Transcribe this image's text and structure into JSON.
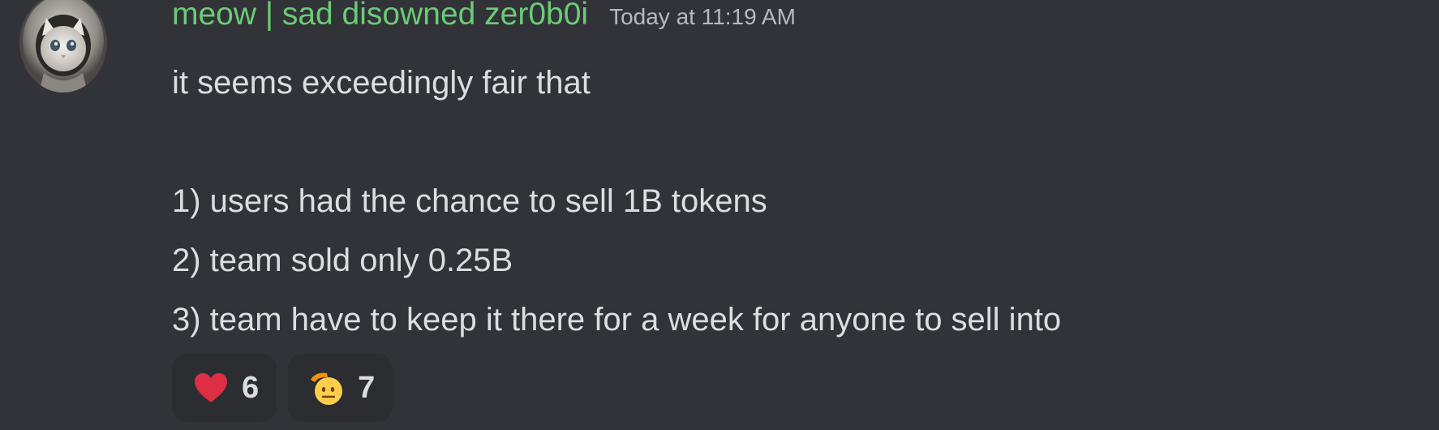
{
  "message": {
    "author": "meow | sad disowned zer0b0i",
    "timestamp": "Today at 11:19 AM",
    "lines": [
      "it seems exceedingly fair that",
      "",
      "1) users had the chance to sell 1B tokens",
      "2) team sold only 0.25B",
      "3) team have to keep it there for a week for anyone to sell into"
    ],
    "avatar_icon": "cat-astronaut-avatar"
  },
  "reactions": [
    {
      "icon": "red-heart-icon",
      "count": "6"
    },
    {
      "icon": "saluting-face-icon",
      "count": "7"
    }
  ],
  "colors": {
    "background": "#313338",
    "username": "#6ccb76",
    "text": "#dbdee1",
    "timestamp": "#b5bac1",
    "reaction_bg": "#2b2d31"
  }
}
